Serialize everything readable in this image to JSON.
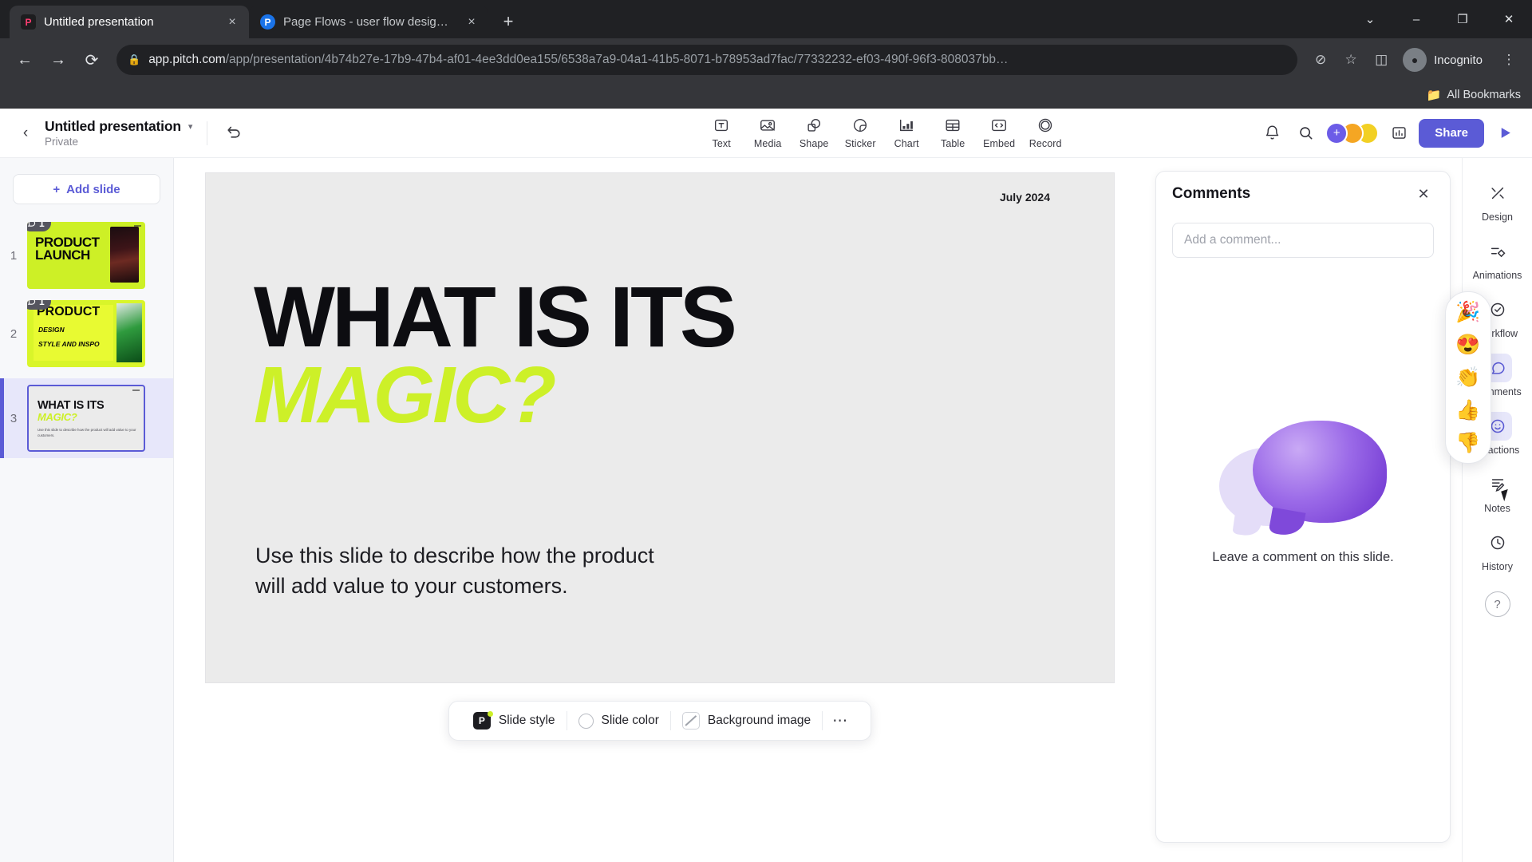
{
  "browser": {
    "tabs": [
      {
        "title": "Untitled presentation",
        "favicon": "pitch-logo-icon",
        "active": true,
        "close_label": "×"
      },
      {
        "title": "Page Flows - user flow design in",
        "favicon": "pitch-circle-icon",
        "active": false,
        "close_label": "×"
      }
    ],
    "new_tab_label": "+",
    "window_controls": {
      "minimize": "–",
      "maximize": "❐",
      "close": "✕",
      "chevron": "⌄"
    },
    "nav": {
      "back": "←",
      "forward": "→",
      "reload": "⟳"
    },
    "url": {
      "lock_icon": "lock-icon",
      "domain": "app.pitch.com",
      "path": "/app/presentation/4b74b27e-17b9-47b4-af01-4ee3dd0ea155/6538a7a9-04a1-41b5-8071-b78953ad7fac/77332232-ef03-490f-96f3-808037bb…"
    },
    "omnibox_icons": {
      "eye_off": "⊘",
      "star": "☆",
      "sidepanel": "◫",
      "menu": "⋮"
    },
    "profile": {
      "label": "Incognito",
      "avatar_icon": "incognito-avatar-icon"
    },
    "bookmarks": {
      "folder_icon": "folder-icon",
      "label": "All Bookmarks"
    }
  },
  "app": {
    "back_icon": "chevron-left-icon",
    "presentation_title": "Untitled presentation",
    "title_caret": "▾",
    "privacy": "Private",
    "undo_icon": "undo-icon",
    "toolbar": [
      {
        "label": "Text",
        "icon": "text-icon"
      },
      {
        "label": "Media",
        "icon": "media-icon"
      },
      {
        "label": "Shape",
        "icon": "shape-icon"
      },
      {
        "label": "Sticker",
        "icon": "sticker-icon"
      },
      {
        "label": "Chart",
        "icon": "chart-icon"
      },
      {
        "label": "Table",
        "icon": "table-icon"
      },
      {
        "label": "Embed",
        "icon": "embed-icon"
      },
      {
        "label": "Record",
        "icon": "record-icon"
      }
    ],
    "top_right": {
      "bell_icon": "bell-icon",
      "search_icon": "search-icon",
      "avatar_plus": "+",
      "analytics_icon": "analytics-icon",
      "share_label": "Share",
      "play_icon": "play-icon"
    },
    "accent_color": "#5b5bd6",
    "brand_yellow": "#cdf028"
  },
  "sidebar": {
    "add_slide_label": "Add slide",
    "add_slide_plus": "+",
    "slides": [
      {
        "number": "1",
        "comment_count": "1",
        "comment_icon": "comment-icon",
        "title_line1": "PRODUCT",
        "title_line2": "LAUNCH",
        "selected": false
      },
      {
        "number": "2",
        "comment_count": "1",
        "comment_icon": "comment-icon",
        "title_line1": "PRODUCT",
        "sub1": "DESIGN",
        "sub2": "STYLE AND INSPO",
        "selected": false
      },
      {
        "number": "3",
        "title_line1": "WHAT IS ITS",
        "title_line2": "MAGIC?",
        "body": "Use this slide to describe how the product will add value to your customers.",
        "selected": true
      }
    ]
  },
  "slide": {
    "date": "July 2024",
    "heading_line1": "WHAT IS ITS",
    "heading_line2": "MAGIC?",
    "body_line1": "Use this slide to describe how the product",
    "body_line2": "will add value to your customers."
  },
  "style_bar": {
    "pitch_chip": "P",
    "slide_style_label": "Slide style",
    "slide_color_label": "Slide color",
    "background_image_label": "Background image",
    "more_label": "⋯"
  },
  "comments_panel": {
    "title": "Comments",
    "close_icon": "✕",
    "input_placeholder": "Add a comment...",
    "empty_message": "Leave a comment on this slide.",
    "illustration": "speech-bubbles-illustration"
  },
  "reactions_popover": {
    "items": [
      {
        "emoji": "🎉",
        "name": "party-popper-reaction"
      },
      {
        "emoji": "😍",
        "name": "heart-eyes-reaction"
      },
      {
        "emoji": "👏",
        "name": "clap-reaction"
      },
      {
        "emoji": "👍",
        "name": "thumbs-up-reaction"
      },
      {
        "emoji": "👎",
        "name": "thumbs-down-reaction"
      }
    ]
  },
  "right_rail": [
    {
      "label": "Design",
      "icon": "design-icon",
      "active": false
    },
    {
      "label": "Animations",
      "icon": "animations-icon",
      "active": false
    },
    {
      "label": "Workflow",
      "icon": "workflow-icon",
      "active": false
    },
    {
      "label": "Comments",
      "icon": "comments-icon",
      "active": true
    },
    {
      "label": "Reactions",
      "icon": "reactions-icon",
      "active": true
    },
    {
      "label": "Notes",
      "icon": "notes-icon",
      "active": false
    },
    {
      "label": "History",
      "icon": "history-icon",
      "active": false
    }
  ],
  "help_icon": "?"
}
